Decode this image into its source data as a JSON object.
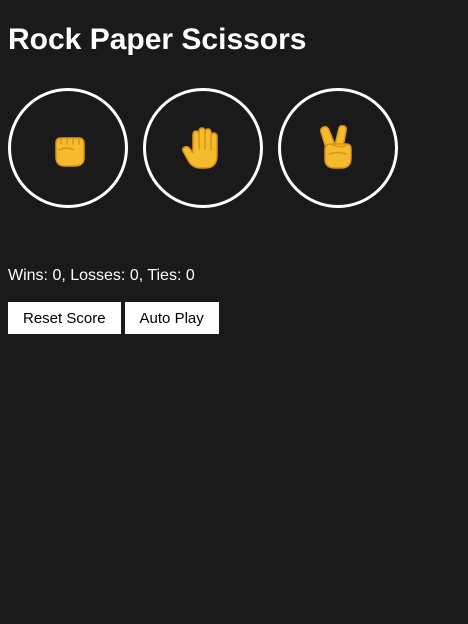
{
  "app": {
    "title": "Rock Paper Scissors"
  },
  "moves": [
    {
      "name": "Rock",
      "icon": "rock-fist-icon"
    },
    {
      "name": "Paper",
      "icon": "paper-hand-icon"
    },
    {
      "name": "Scissors",
      "icon": "scissors-victory-hand-icon"
    }
  ],
  "score": {
    "text": "Wins: 0, Losses: 0, Ties: 0"
  },
  "controls": {
    "reset_label": "Reset Score",
    "autoplay_label": "Auto Play"
  },
  "colors": {
    "background": "#1a1a1a",
    "emoji": "#f5bb2e",
    "emoji_outline": "#d99418"
  }
}
